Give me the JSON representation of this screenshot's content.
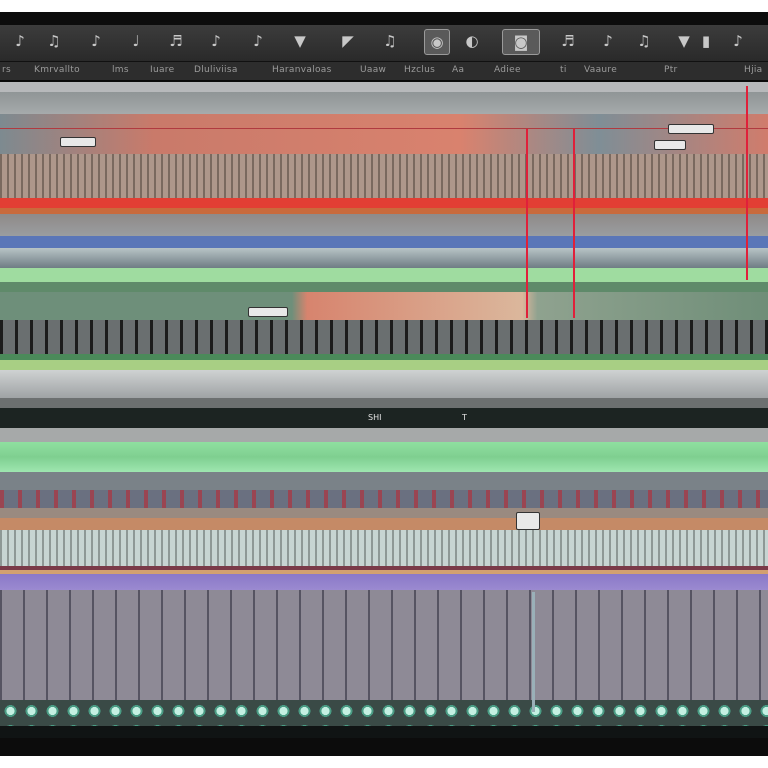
{
  "toolbar": {
    "icons": [
      {
        "name": "speaker-icon",
        "glyph": "♪"
      },
      {
        "name": "note-icon",
        "glyph": "♫"
      },
      {
        "name": "volume-icon",
        "glyph": "♪"
      },
      {
        "name": "metronome-icon",
        "glyph": "♩"
      },
      {
        "name": "mixer-icon",
        "glyph": "♬"
      },
      {
        "name": "headphones-icon",
        "glyph": "♪"
      },
      {
        "name": "triangle-down-icon",
        "glyph": "▼"
      },
      {
        "name": "pointer-icon",
        "glyph": "◤"
      },
      {
        "name": "tuner-icon",
        "glyph": "♫"
      },
      {
        "name": "record-icon",
        "glyph": "◉"
      },
      {
        "name": "loop-icon",
        "glyph": "◐"
      },
      {
        "name": "camera-icon",
        "glyph": "◙"
      },
      {
        "name": "audio-icon",
        "glyph": "♪"
      },
      {
        "name": "midi-icon",
        "glyph": "♬"
      },
      {
        "name": "edit-icon",
        "glyph": "♪"
      },
      {
        "name": "play-marker-icon",
        "glyph": "▼"
      },
      {
        "name": "bar-icon",
        "glyph": "▮"
      },
      {
        "name": "settings-icon",
        "glyph": "♫"
      }
    ]
  },
  "labels": [
    "rs",
    "Kmrvallto",
    "lms",
    "Iuare",
    "Dluliviisa",
    "Haranvaloas",
    "Uaaw",
    "Hzclus",
    "Aa",
    "Adiee",
    "ti",
    "Vaaure",
    "Ptr",
    "Hjia"
  ],
  "tracks": {
    "mid_label": "SHI",
    "tag_label": "T"
  },
  "colors": {
    "accent_red": "#e0203a",
    "track_green": "#8ad69a",
    "track_blue": "#5a76b8",
    "track_salmon": "#d9826e"
  }
}
